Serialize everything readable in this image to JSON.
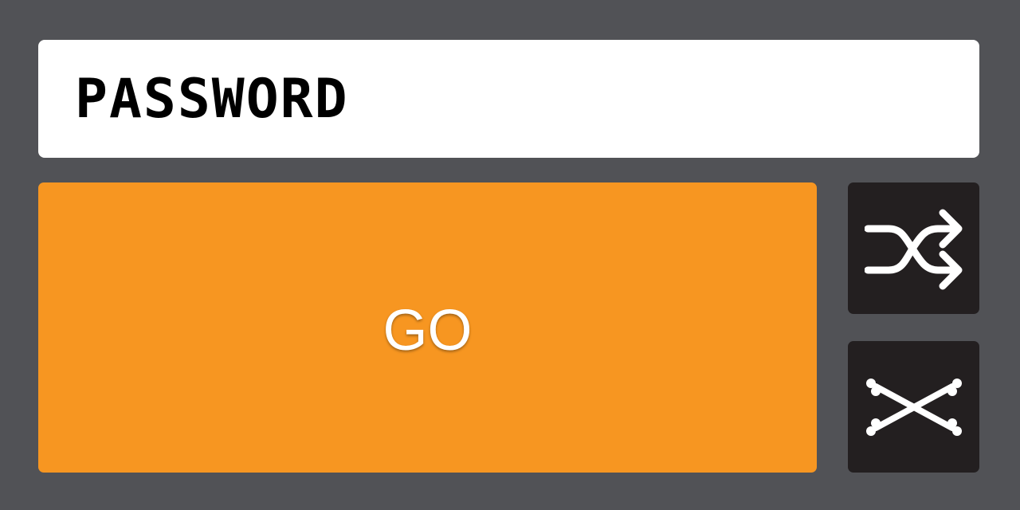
{
  "password": {
    "placeholder": "PASSWORD",
    "value": ""
  },
  "go_button": {
    "label": "GO"
  },
  "side_buttons": {
    "shuffle": {
      "icon": "shuffle-icon"
    },
    "delete": {
      "icon": "crossbones-icon"
    }
  },
  "colors": {
    "background": "#515256",
    "accent": "#f79621",
    "icon_button": "#231f20",
    "field": "#ffffff"
  }
}
